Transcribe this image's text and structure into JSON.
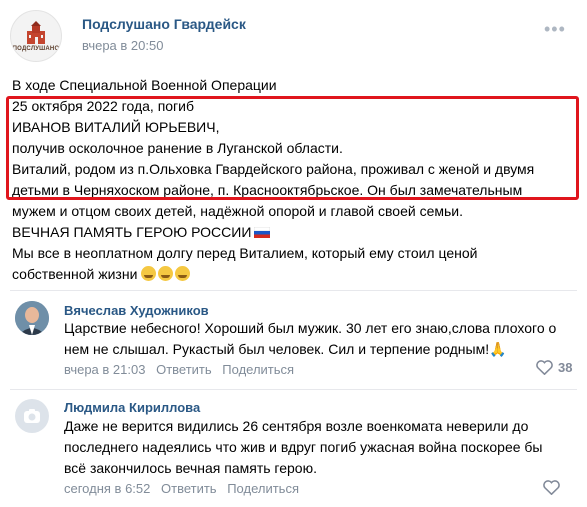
{
  "post": {
    "group_name": "Подслушано Гвардейск",
    "logo_text": "ПОДСЛУШАНО",
    "time": "вчера в 20:50",
    "lines": [
      "В ходе Специальной Военной Операции",
      "25 октября 2022 года, погиб",
      "ИВАНОВ ВИТАЛИЙ ЮРЬЕВИЧ,",
      "получив осколочное ранение в Луганской области.",
      "Виталий, родом из п.Ольховка Гвардейского района, проживал с женой и двумя",
      "детьми в Черняхоском районе, п. Краснооктябрьское. Он был замечательным",
      "мужем и отцом своих детей, надёжной опорой и главой своей семьи.",
      "ВЕЧНАЯ ПАМЯТЬ ГЕРОЮ РОССИИ",
      "Мы все в неоплатном долгу перед Виталием, который ему стоил ценой",
      "собственной жизни"
    ]
  },
  "comments": [
    {
      "author": "Вячеслав Художников",
      "lines": [
        "Царствие небесного! Хороший был мужик. 30 лет его знаю,слова плохого о",
        "нем не слышал. Рукастый был человек. Сил и терпение родным!🙏"
      ],
      "time": "вчера в 21:03",
      "reply_label": "Ответить",
      "share_label": "Поделиться",
      "likes": "38"
    },
    {
      "author": "Людмила Кириллова",
      "lines": [
        "Даже не верится видились 26 сентября возле военкомата неверили до",
        "последнего надеялись что жив и вдруг погиб ужасная война поскорее бы",
        "всё закончилось вечная память герою."
      ],
      "time": "сегодня в 6:52",
      "reply_label": "Ответить",
      "share_label": "Поделиться",
      "likes": ""
    }
  ],
  "colors": {
    "link": "#2a5885",
    "meta": "#818c99",
    "highlight": "#e0151d"
  }
}
